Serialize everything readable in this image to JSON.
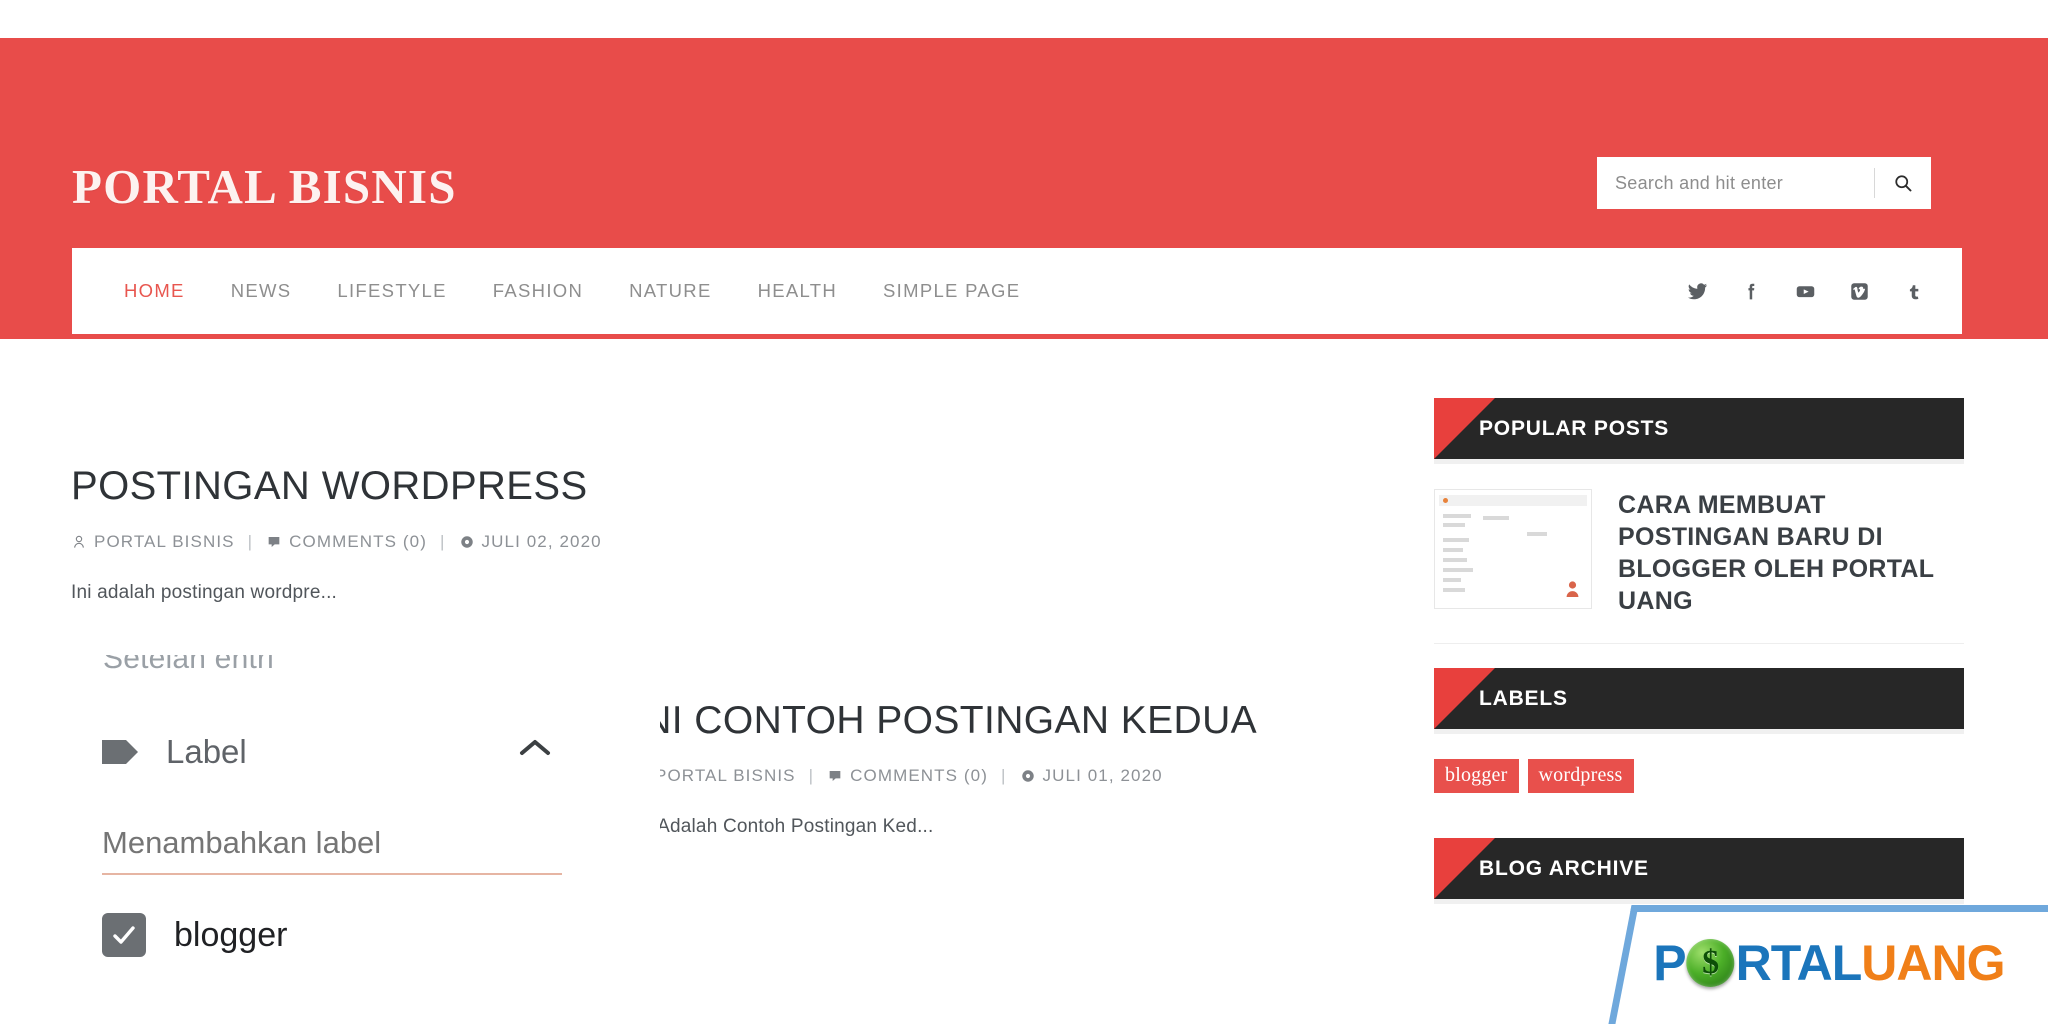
{
  "site": {
    "title": "PORTAL BISNIS",
    "accent_red": "#E84C4A",
    "dark": "#272727"
  },
  "search": {
    "placeholder": "Search and hit enter",
    "value": "",
    "icon": "search-icon"
  },
  "nav": {
    "items": [
      {
        "label": "HOME",
        "active": true
      },
      {
        "label": "NEWS",
        "active": false
      },
      {
        "label": "LIFESTYLE",
        "active": false
      },
      {
        "label": "FASHION",
        "active": false
      },
      {
        "label": "NATURE",
        "active": false
      },
      {
        "label": "HEALTH",
        "active": false
      },
      {
        "label": "SIMPLE PAGE",
        "active": false
      }
    ],
    "social": [
      {
        "name": "twitter-icon"
      },
      {
        "name": "facebook-icon"
      },
      {
        "name": "youtube-icon"
      },
      {
        "name": "vimeo-icon"
      },
      {
        "name": "tumblr-icon"
      }
    ]
  },
  "posts": [
    {
      "title": "POSTINGAN WORDPRESS",
      "author": "PORTAL BISNIS",
      "comments": "COMMENTS (0)",
      "date": "JULI 02, 2020",
      "excerpt": "Ini adalah postingan wordpre...",
      "separator": "|"
    },
    {
      "title": "INI CONTOH POSTINGAN KEDUA",
      "author": "PORTAL BISNIS",
      "comments": "COMMENTS (0)",
      "date": "JULI 01, 2020",
      "excerpt": "Ini Adalah Contoh Postingan Ked...",
      "separator": "|"
    }
  ],
  "blogger_panel": {
    "clipped_heading": "Setelan entri",
    "label_row": "Label",
    "tag_icon": "tag-icon",
    "chevron": "chevron-up-icon",
    "add_label_placeholder": "Menambahkan label",
    "add_label_value": "",
    "checkbox_label": "blogger",
    "checkbox_checked": true
  },
  "sidebar": {
    "widgets": [
      {
        "title": "POPULAR POSTS",
        "type": "popular",
        "items": [
          {
            "title": "CARA MEMBUAT POSTINGAN BARU DI BLOGGER OLEH PORTAL UANG"
          }
        ]
      },
      {
        "title": "LABELS",
        "type": "labels",
        "labels": [
          "blogger",
          "wordpress"
        ]
      },
      {
        "title": "BLOG ARCHIVE",
        "type": "archive",
        "labels": []
      }
    ]
  },
  "annotations": {
    "arrow": {
      "name": "red-arrow-annotation",
      "color": "#E01B22",
      "direction": "up-left"
    }
  },
  "logo_overlay": {
    "part_1": "P",
    "coin_symbol": "$",
    "part_2": "RTAL",
    "part_3": "UANG",
    "blue": "#1B75BB",
    "orange": "#F07F18",
    "border": "#6FA8DC"
  }
}
